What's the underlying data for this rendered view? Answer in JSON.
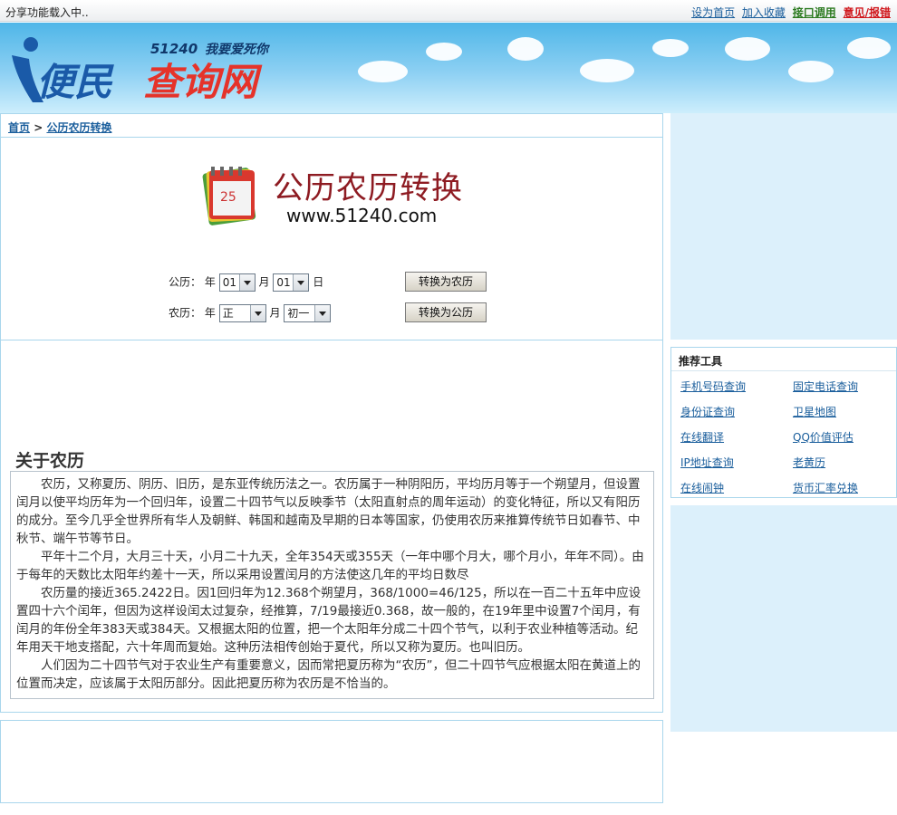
{
  "topbar": {
    "share_text": "分享功能载入中..",
    "links": {
      "home": "设为首页",
      "fav": "加入收藏",
      "api": "接口调用",
      "report": "意见/报错"
    }
  },
  "logo": {
    "slogan": "51240 我要爱死你",
    "main": "便民查询网"
  },
  "breadcrumb": {
    "home": "首页",
    "sep": " > ",
    "current": "公历农历转换"
  },
  "banner": {
    "title": "公历农历转换",
    "url": "www.51240.com"
  },
  "form": {
    "solar_label": "公历：",
    "lunar_label": "农历：",
    "year_label": "年",
    "month_label": "月",
    "day_label": "日",
    "solar_month": "01",
    "solar_day": "01",
    "lunar_month": "正",
    "lunar_day": "初一",
    "to_lunar_btn": "转换为农历",
    "to_solar_btn": "转换为公历"
  },
  "about": {
    "title": "关于农历",
    "p1": "农历，又称夏历、阴历、旧历，是东亚传统历法之一。农历属于一种阴阳历，平均历月等于一个朔望月，但设置闰月以使平均历年为一个回归年，设置二十四节气以反映季节（太阳直射点的周年运动）的变化特征，所以又有阳历的成分。至今几乎全世界所有华人及朝鲜、韩国和越南及早期的日本等国家，仍使用农历来推算传统节日如春节、中秋节、端午节等节日。",
    "p2": "平年十二个月，大月三十天，小月二十九天，全年354天或355天（一年中哪个月大，哪个月小，年年不同）。由于每年的天数比太阳年约差十一天，所以采用设置闰月的方法使这几年的平均日数尽",
    "p3": "农历量的接近365.2422日。因1回归年为12.368个朔望月，368/1000=46/125，所以在一百二十五年中应设置四十六个闰年，但因为这样设闰太过复杂，经推算，7/19最接近0.368，故一般的，在19年里中设置7个闰月，有闰月的年份全年383天或384天。又根据太阳的位置，把一个太阳年分成二十四个节气，以利于农业种植等活动。纪年用天干地支搭配，六十年周而复始。这种历法相传创始于夏代，所以又称为夏历。也叫旧历。",
    "p4": "人们因为二十四节气对于农业生产有重要意义，因而常把夏历称为“农历”，但二十四节气应根据太阳在黄道上的位置而决定，应该属于太阳历部分。因此把夏历称为农历是不恰当的。"
  },
  "recommend": {
    "title": "推荐工具",
    "items": [
      "手机号码查询",
      "固定电话查询",
      "身份证查询",
      "卫星地图",
      "在线翻译",
      "QQ价值评估",
      "IP地址查询",
      "老黄历",
      "在线闹钟",
      "货币汇率兑换"
    ]
  },
  "colors": {
    "link": "#1a5e9c",
    "green": "#2b7a1f",
    "red": "#d0161b",
    "border": "#a9d6ec",
    "sky": "#4fb6e8"
  }
}
